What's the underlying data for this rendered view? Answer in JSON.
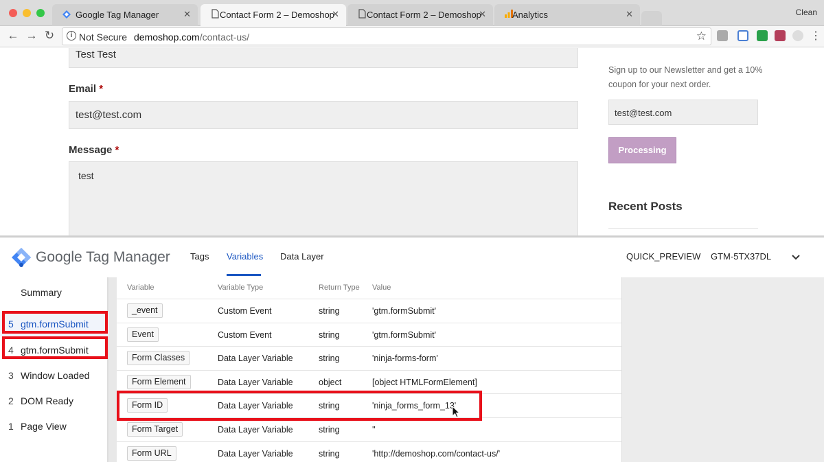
{
  "browser": {
    "tabs": [
      {
        "label": "Google Tag Manager",
        "icon": "gtm-icon",
        "active": false
      },
      {
        "label": "Contact Form 2 – Demoshop",
        "icon": "page-icon",
        "active": true
      },
      {
        "label": "Contact Form 2 – Demoshop",
        "icon": "page-icon",
        "active": false
      },
      {
        "label": "Analytics",
        "icon": "analytics-icon",
        "active": false
      }
    ],
    "profile_label": "Clean",
    "security": "Not Secure",
    "url_host": "demoshop.com",
    "url_path": "/contact-us/"
  },
  "page": {
    "name_value": "Test Test",
    "email_label": "Email",
    "email_value": "test@test.com",
    "message_label": "Message",
    "message_value": "test",
    "required_marker": "*",
    "newsletter_text_1": "Sign up to our Newsletter and get a 10%",
    "newsletter_text_2": "coupon for your next order.",
    "newsletter_email": "test@test.com",
    "processing_label": "Processing",
    "recent_posts_heading": "Recent Posts"
  },
  "gtm": {
    "brand_google": "Google",
    "brand_rest": " Tag Manager",
    "tabs": [
      "Tags",
      "Variables",
      "Data Layer"
    ],
    "selected_tab": "Variables",
    "preview_label": "QUICK_PREVIEW",
    "container_id": "GTM-5TX37DL",
    "sidebar": {
      "summary": "Summary",
      "events": [
        {
          "num": "5",
          "label": "gtm.formSubmit"
        },
        {
          "num": "4",
          "label": "gtm.formSubmit"
        },
        {
          "num": "3",
          "label": "Window Loaded"
        },
        {
          "num": "2",
          "label": "DOM Ready"
        },
        {
          "num": "1",
          "label": "Page View"
        }
      ]
    },
    "table": {
      "headers": [
        "Variable",
        "Variable Type",
        "Return Type",
        "Value"
      ],
      "rows": [
        {
          "variable": "_event",
          "type": "Custom Event",
          "return": "string",
          "value": "'gtm.formSubmit'"
        },
        {
          "variable": "Event",
          "type": "Custom Event",
          "return": "string",
          "value": "'gtm.formSubmit'"
        },
        {
          "variable": "Form Classes",
          "type": "Data Layer Variable",
          "return": "string",
          "value": "'ninja-forms-form'"
        },
        {
          "variable": "Form Element",
          "type": "Data Layer Variable",
          "return": "object",
          "value": "[object HTMLFormElement]"
        },
        {
          "variable": "Form ID",
          "type": "Data Layer Variable",
          "return": "string",
          "value": "'ninja_forms_form_13'"
        },
        {
          "variable": "Form Target",
          "type": "Data Layer Variable",
          "return": "string",
          "value": "''"
        },
        {
          "variable": "Form URL",
          "type": "Data Layer Variable",
          "return": "string",
          "value": "'http://demoshop.com/contact-us/'"
        }
      ]
    }
  },
  "colors": {
    "highlight": "#e8101a",
    "gtm_blue": "#1a56c2",
    "processing": "#c29ec4"
  }
}
